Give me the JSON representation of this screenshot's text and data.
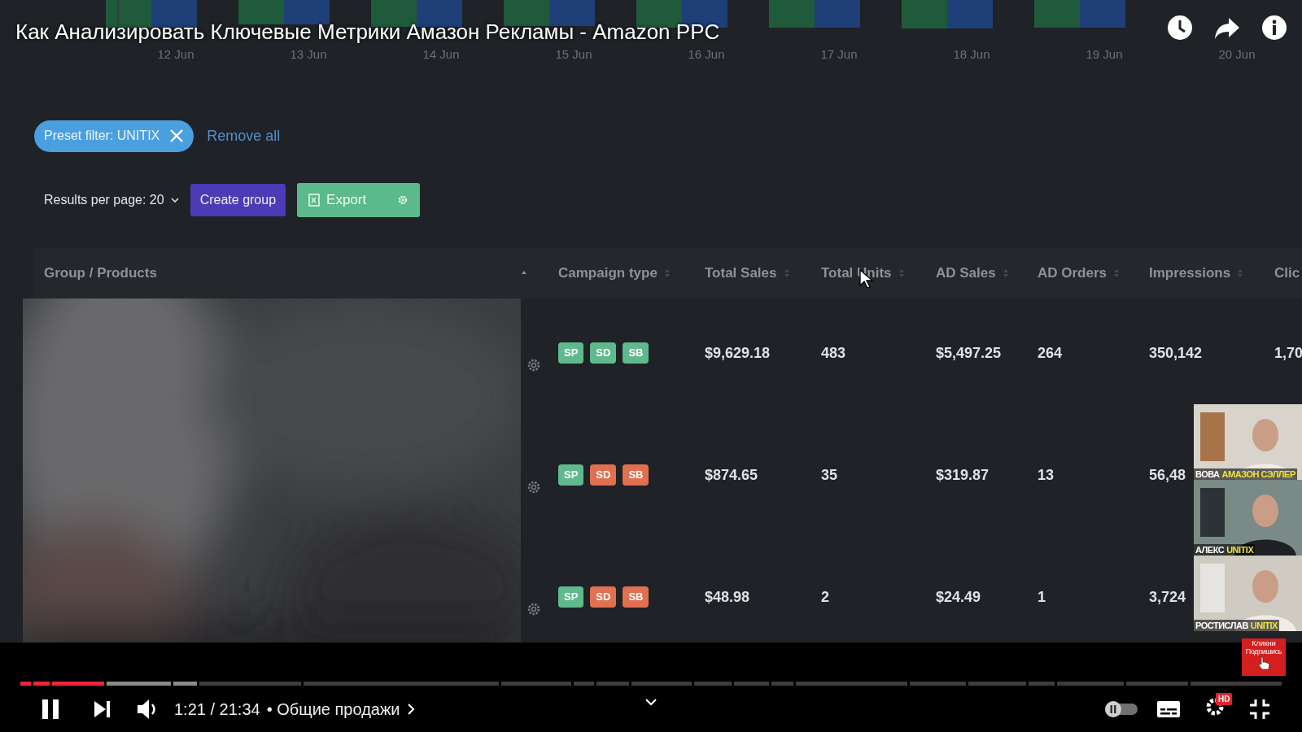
{
  "video": {
    "title": "Как Анализировать Ключевые Метрики Амазон Рекламы - Amazon PPC",
    "chart_axis": [
      "12 Jun",
      "13 Jun",
      "14 Jun",
      "15 Jun",
      "16 Jun",
      "17 Jun",
      "18 Jun",
      "19 Jun",
      "20 Jun"
    ],
    "filters": [
      {
        "label": "Preset filter: UNITIX"
      }
    ],
    "remove_all": "Remove all",
    "results_per_page": "Results per page: 20",
    "create_group": "Create group",
    "export": "Export",
    "table": {
      "columns": [
        "Group / Products",
        "Campaign type",
        "Total Sales",
        "Total Units",
        "AD Sales",
        "AD Orders",
        "Impressions",
        "Clic"
      ],
      "rows": [
        {
          "campaign_types": [
            {
              "label": "SP",
              "color": "#5fb98c"
            },
            {
              "label": "SD",
              "color": "#5fb98c"
            },
            {
              "label": "SB",
              "color": "#5fb98c"
            }
          ],
          "cells": [
            "",
            "",
            "$9,629.18",
            "483",
            "$5,497.25",
            "264",
            "350,142",
            "1,70"
          ]
        },
        {
          "campaign_types": [
            {
              "label": "SP",
              "color": "#5fb98c"
            },
            {
              "label": "SD",
              "color": "#e0704f"
            },
            {
              "label": "SB",
              "color": "#e0704f"
            }
          ],
          "cells": [
            "",
            "",
            "$874.65",
            "35",
            "$319.87",
            "13",
            "56,48"
          ]
        },
        {
          "campaign_types": [
            {
              "label": "SP",
              "color": "#5fb98c"
            },
            {
              "label": "SD",
              "color": "#e0704f"
            },
            {
              "label": "SB",
              "color": "#e0704f"
            }
          ],
          "cells": [
            "",
            "",
            "$48.98",
            "2",
            "$24.49",
            "1",
            "3,724"
          ]
        }
      ]
    },
    "webcams": [
      {
        "name": "ВОВА",
        "tag": "АМАЗОН СЭЛЛЕР"
      },
      {
        "name": "АЛЕКС",
        "tag": "UNITIX"
      },
      {
        "name": "РОСТИСЛАВ",
        "tag": "UNITIX"
      }
    ],
    "subscribe": {
      "line_1": "Кликни",
      "line_2": "Подпишись"
    }
  },
  "player": {
    "progress": {
      "level": 0.068
    },
    "buffer": {
      "level": 0.14
    },
    "time": "1:21 / 21:34",
    "chapter": "• Общие продажи",
    "autoplay": {
      "on": false
    },
    "quality_badge": "HD"
  }
}
